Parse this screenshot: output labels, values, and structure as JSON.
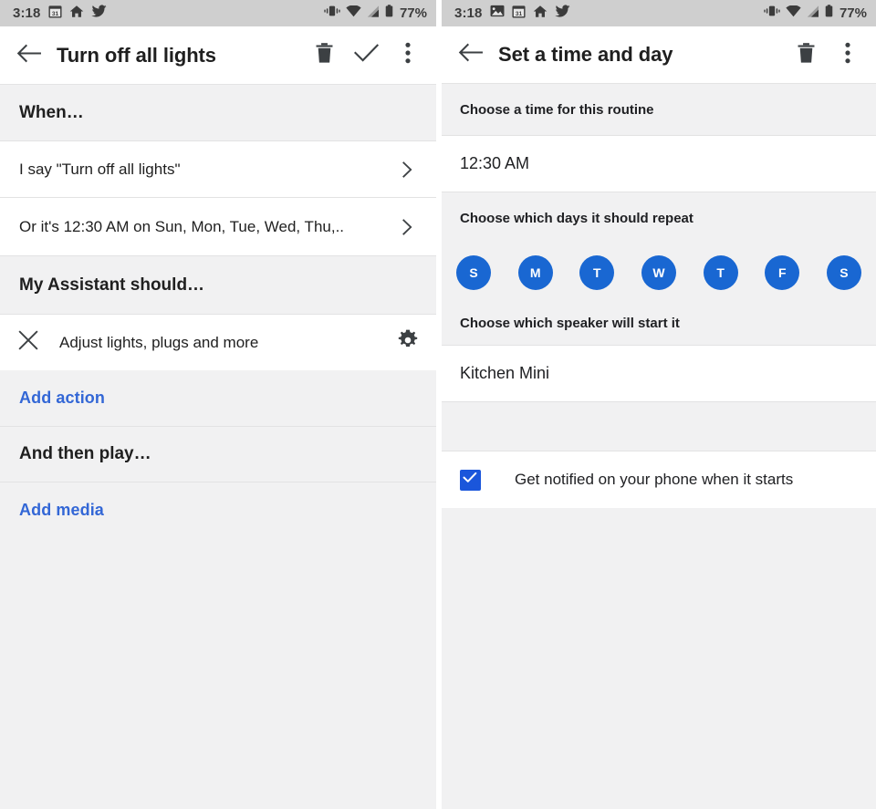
{
  "theme": {
    "accent_blue": "#1a73e8",
    "link_blue": "#3367d6",
    "chip_blue": "#1967d2",
    "statusbar_bg": "#cfcfcf",
    "section_bg": "#f1f1f2",
    "row_bg": "#ffffff",
    "text_primary": "#1f1f1f",
    "divider": "#e2e2e3"
  },
  "left": {
    "statusbar": {
      "time": "3:18",
      "left_icons": [
        "calendar-icon",
        "home-icon",
        "twitter-icon"
      ],
      "right_icons": [
        "vibrate-icon",
        "wifi-icon",
        "cell-signal-icon",
        "battery-icon"
      ],
      "battery_percent": "77%"
    },
    "appbar": {
      "back_icon": "arrow-back-icon",
      "title": "Turn off all lights",
      "actions": [
        "delete-icon",
        "check-icon",
        "overflow-menu-icon"
      ]
    },
    "sections": [
      {
        "type": "header",
        "label": "When…"
      },
      {
        "type": "nav",
        "label": "I say \"Turn off all lights\"",
        "chevron": "chevron-right-icon"
      },
      {
        "type": "nav",
        "label": "Or it's 12:30 AM on Sun, Mon, Tue, Wed, Thu,..",
        "chevron": "chevron-right-icon"
      },
      {
        "type": "header",
        "label": "My Assistant should…"
      },
      {
        "type": "action",
        "remove_icon": "close-icon",
        "label": "Adjust lights, plugs and more",
        "settings_icon": "gear-icon"
      },
      {
        "type": "link",
        "label": "Add action"
      },
      {
        "type": "header",
        "label": "And then play…"
      },
      {
        "type": "link",
        "label": "Add media"
      }
    ]
  },
  "right": {
    "statusbar": {
      "time": "3:18",
      "left_icons": [
        "image-icon",
        "calendar-icon",
        "home-icon",
        "twitter-icon"
      ],
      "right_icons": [
        "vibrate-icon",
        "wifi-icon",
        "cell-signal-icon",
        "battery-icon"
      ],
      "battery_percent": "77%"
    },
    "appbar": {
      "back_icon": "arrow-back-icon",
      "title": "Set a time and day",
      "actions": [
        "delete-icon",
        "overflow-menu-icon"
      ]
    },
    "time_section": {
      "heading": "Choose a time for this routine",
      "value": "12:30 AM"
    },
    "days_section": {
      "heading": "Choose which days it should repeat",
      "days": [
        {
          "label": "S",
          "name": "sunday",
          "selected": true
        },
        {
          "label": "M",
          "name": "monday",
          "selected": true
        },
        {
          "label": "T",
          "name": "tuesday",
          "selected": true
        },
        {
          "label": "W",
          "name": "wednesday",
          "selected": true
        },
        {
          "label": "T",
          "name": "thursday",
          "selected": true
        },
        {
          "label": "F",
          "name": "friday",
          "selected": true
        },
        {
          "label": "S",
          "name": "saturday",
          "selected": true
        }
      ]
    },
    "speaker_section": {
      "heading": "Choose which speaker will start it",
      "value": "Kitchen Mini"
    },
    "notify": {
      "label": "Get notified on your phone when it starts",
      "checked": true,
      "check_icon": "checkmark-icon"
    }
  }
}
